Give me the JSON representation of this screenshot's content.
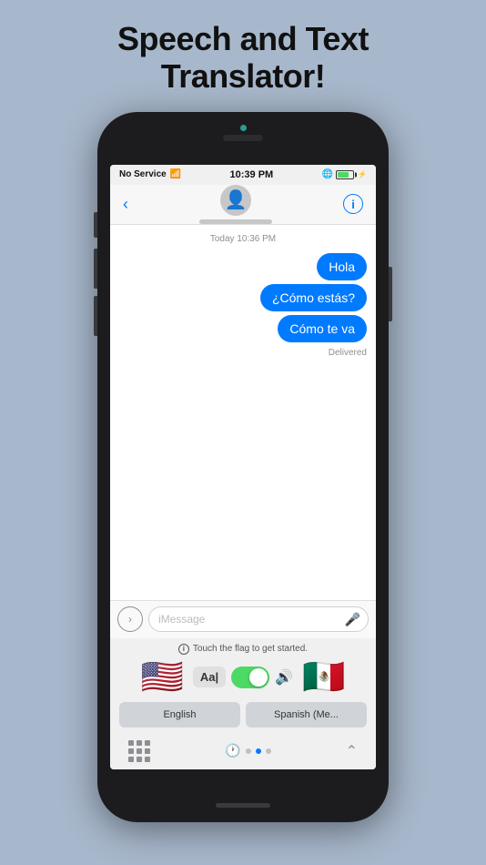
{
  "header": {
    "title_line1": "Speech and Text",
    "title_line2": "Translator!"
  },
  "status_bar": {
    "carrier": "No Service",
    "time": "10:39 PM",
    "battery_label": "⚡"
  },
  "nav": {
    "back_icon": "‹",
    "info_icon": "i"
  },
  "chat": {
    "timestamp": "Today 10:36 PM",
    "messages": [
      {
        "text": "Hola"
      },
      {
        "text": "¿Cómo estás?"
      },
      {
        "text": "Cómo te va"
      }
    ],
    "delivered": "Delivered"
  },
  "input_bar": {
    "placeholder": "iMessage",
    "expand_icon": "›"
  },
  "translator": {
    "hint": "Touch the flag to get started.",
    "aa_label": "Aa|",
    "flag_left": "🇺🇸",
    "flag_right": "🇲🇽",
    "lang_left": "English",
    "lang_right": "Spanish (Me...",
    "speaker_icon": "🔊"
  },
  "bottom_bar": {
    "chevron": "^"
  },
  "colors": {
    "accent": "#007aff",
    "bubble": "#007aff",
    "toggle": "#4cd964",
    "background": "#a8b8cc"
  }
}
